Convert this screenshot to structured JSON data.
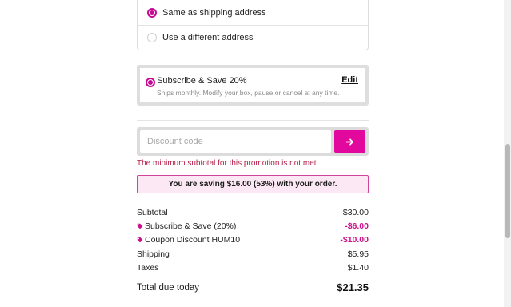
{
  "billing": {
    "option_same": "Same as shipping address",
    "option_different": "Use a different address"
  },
  "subscription": {
    "title": "Subscribe & Save 20%",
    "edit_label": "Edit",
    "description": "Ships monthly. Modify your box, pause or cancel at any time."
  },
  "discount": {
    "placeholder": "Discount code",
    "value": "",
    "submit_icon": "arrow-right-icon",
    "error": "The minimum subtotal for this promotion is not met."
  },
  "savings_banner": "You are saving $16.00 (53%) with your order.",
  "summary": {
    "subtotal_label": "Subtotal",
    "subtotal_value": "$30.00",
    "subscribe_label": "Subscribe & Save (20%)",
    "subscribe_value": "-$6.00",
    "coupon_label": "Coupon Discount HUM10",
    "coupon_value": "-$10.00",
    "shipping_label": "Shipping",
    "shipping_value": "$5.95",
    "taxes_label": "Taxes",
    "taxes_value": "$1.40",
    "total_label": "Total due today",
    "total_value": "$21.35"
  },
  "colors": {
    "accent": "#e2079d",
    "discount_text": "#cc0e8a",
    "error_text": "#b3224a",
    "banner_bg": "#fce8f4"
  }
}
